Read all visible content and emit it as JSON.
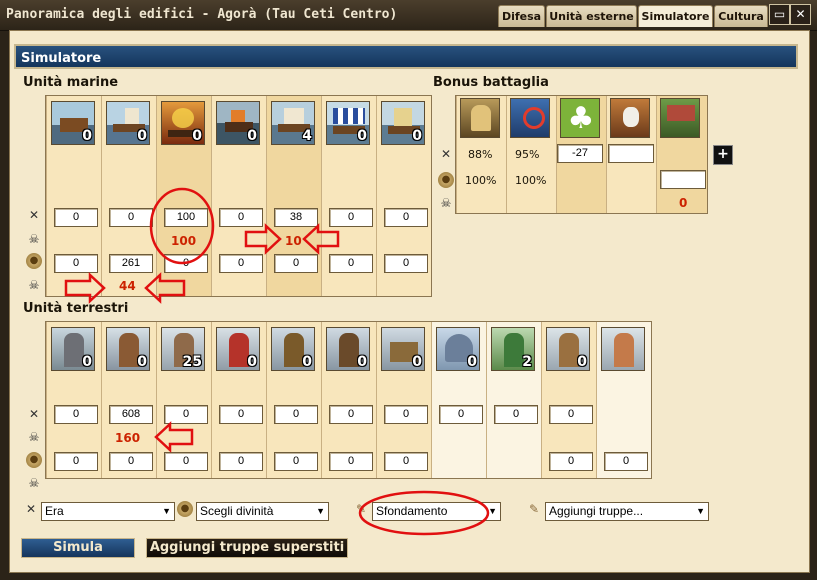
{
  "window": {
    "title": "Panoramica degli edifici - Agorà (Tau Ceti Centro)"
  },
  "tabs": [
    {
      "label": "Difesa"
    },
    {
      "label": "Unità esterne"
    },
    {
      "label": "Simulatore",
      "active": true
    },
    {
      "label": "Cultura"
    }
  ],
  "panel": {
    "header": "Simulatore"
  },
  "naval": {
    "title": "Unità marine",
    "units": [
      {
        "name": "big-transporter",
        "count": "0"
      },
      {
        "name": "bireme",
        "count": "0"
      },
      {
        "name": "fire-ship",
        "count": "0"
      },
      {
        "name": "light-ship",
        "count": "0"
      },
      {
        "name": "trireme",
        "count": "4"
      },
      {
        "name": "colonize-ship",
        "count": "0"
      },
      {
        "name": "small-transporter",
        "count": "0"
      }
    ],
    "attack_inputs": [
      "0",
      "0",
      "100",
      "0",
      "38",
      "0",
      "0"
    ],
    "defense_inputs": [
      "0",
      "261",
      "0",
      "0",
      "0",
      "0",
      "0"
    ],
    "attack_losses": {
      "col3": "100",
      "col5": "10"
    },
    "defense_losses": {
      "col2": "44"
    }
  },
  "bonus": {
    "title": "Bonus battaglia",
    "icons": [
      "luck-icon",
      "morale-icon",
      "clover-icon",
      "hero-icon",
      "tower-icon"
    ],
    "attack": [
      "88%",
      "95%"
    ],
    "defense": [
      "100%",
      "100%"
    ],
    "luck_input": "-27",
    "hero_input": "",
    "wall_input": "",
    "wall_loss": "0",
    "add_button": "+"
  },
  "land": {
    "title": "Unità terrestri",
    "units": [
      {
        "name": "militia",
        "count": "0"
      },
      {
        "name": "sword",
        "count": "0"
      },
      {
        "name": "slinger",
        "count": "25"
      },
      {
        "name": "archer",
        "count": "0"
      },
      {
        "name": "hoplite",
        "count": "0"
      },
      {
        "name": "rider",
        "count": "0"
      },
      {
        "name": "catapult",
        "count": "0"
      },
      {
        "name": "harpy",
        "count": "0"
      },
      {
        "name": "medusa",
        "count": "2"
      },
      {
        "name": "centaur",
        "count": "0"
      },
      {
        "name": "extra",
        "count": ""
      }
    ],
    "attack_inputs": [
      "0",
      "608",
      "0",
      "0",
      "0",
      "0",
      "0",
      "0",
      "0",
      "0"
    ],
    "defense_inputs": [
      "0",
      "0",
      "0",
      "0",
      "0",
      "0",
      "0",
      "0",
      "0"
    ],
    "attack_losses": {
      "col2": "160"
    }
  },
  "bottom": {
    "era": "Era",
    "god": "Scegli divinità",
    "strategy": "Sfondamento",
    "add_troops": "Aggiungi truppe...",
    "simulate": "Simula",
    "add_survivors": "Aggiungi truppe superstiti"
  },
  "colors": {
    "header": "#1d4170",
    "annotation": "#e11010",
    "loss": "#cc2200"
  }
}
